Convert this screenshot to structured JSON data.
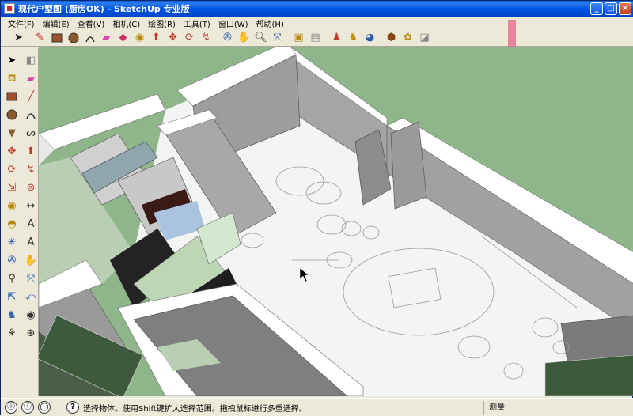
{
  "window": {
    "title": "现代户型图 (厨房OK) - SketchUp 专业版"
  },
  "menubar": {
    "items": [
      "文件(F)",
      "编辑(E)",
      "查看(V)",
      "相机(C)",
      "绘图(R)",
      "工具(T)",
      "窗口(W)",
      "帮助(H)"
    ]
  },
  "toolbar": {
    "icons": [
      "select-icon",
      "pencil-icon",
      "rectangle-icon",
      "circle-icon",
      "eraser-icon",
      "paint-icon",
      "tape-icon",
      "push-pull-icon",
      "move-icon",
      "rotate-icon",
      "follow-me-icon",
      "orbit-icon",
      "pan-icon",
      "zoom-icon",
      "zoom-extents-icon",
      "iso-view-icon",
      "top-view-icon",
      "walk-icon",
      "position-camera-icon",
      "look-around-icon",
      "components-icon",
      "materials-icon",
      "styles-icon"
    ]
  },
  "lefttools": {
    "icons": [
      "select-icon",
      "make-component-icon",
      "paint-bucket-icon",
      "eraser-icon",
      "rectangle-icon",
      "line-icon",
      "circle-icon",
      "arc-icon",
      "polygon-icon",
      "freehand-icon",
      "move-icon",
      "push-pull-icon",
      "rotate-icon",
      "follow-me-icon",
      "scale-icon",
      "offset-icon",
      "tape-measure-icon",
      "dimension-icon",
      "protractor-icon",
      "text-icon",
      "axes-icon",
      "3d-text-icon",
      "orbit-icon",
      "pan-icon",
      "zoom-icon",
      "zoom-window-icon",
      "zoom-extents-icon",
      "previous-view-icon",
      "position-camera-icon",
      "look-around-icon",
      "walk-icon",
      "section-plane-icon"
    ]
  },
  "statusbar": {
    "hint": "选择物体。使用Shift键扩大选择范围。拖拽鼠标进行多重选择。",
    "measure_label": "测量",
    "help": "?"
  },
  "colors": {
    "ground": "#8fb58a",
    "floor": "#f4f6f4",
    "wall": "#a3a3a3",
    "wall_dark": "#7d7d7d",
    "wall_top": "#ffffff"
  }
}
